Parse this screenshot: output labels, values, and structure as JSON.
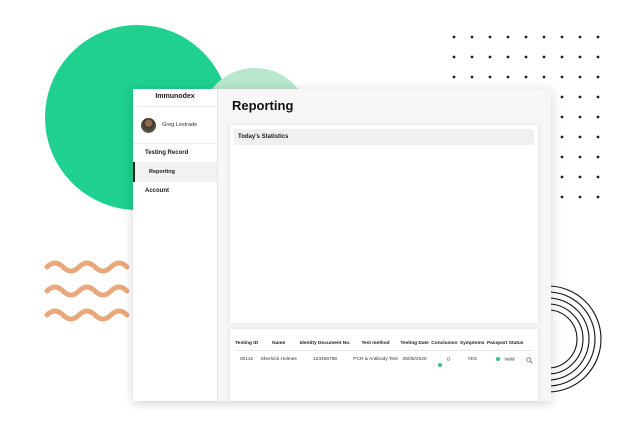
{
  "app": {
    "brand": "Immunodex"
  },
  "user": {
    "name": "Greg Lestrade"
  },
  "sidebar": {
    "items": [
      {
        "label": "Testing Record"
      },
      {
        "label": "Reporting"
      },
      {
        "label": "Account"
      }
    ]
  },
  "page": {
    "title": "Reporting"
  },
  "stats": {
    "header": "Today's Statistics"
  },
  "table": {
    "headers": [
      "Testing ID",
      "Name",
      "Identity Document No.",
      "Test method",
      "Testing Date",
      "Conclusion",
      "Symptoms",
      "Passport Status"
    ],
    "rows": [
      {
        "testing_id": "00131",
        "name": "Sherlock Holmes",
        "identity_doc": "123456789",
        "test_method": "PCR & Antibody Test",
        "testing_date": "26/05/2020",
        "conclusion": "G",
        "symptoms": "YES",
        "passport_status": "Valid"
      }
    ]
  },
  "colors": {
    "accent_green": "#1fd08e",
    "light_green": "#b9e6cf",
    "wave_orange": "#e8a87c",
    "status_green": "#2fc48a"
  }
}
